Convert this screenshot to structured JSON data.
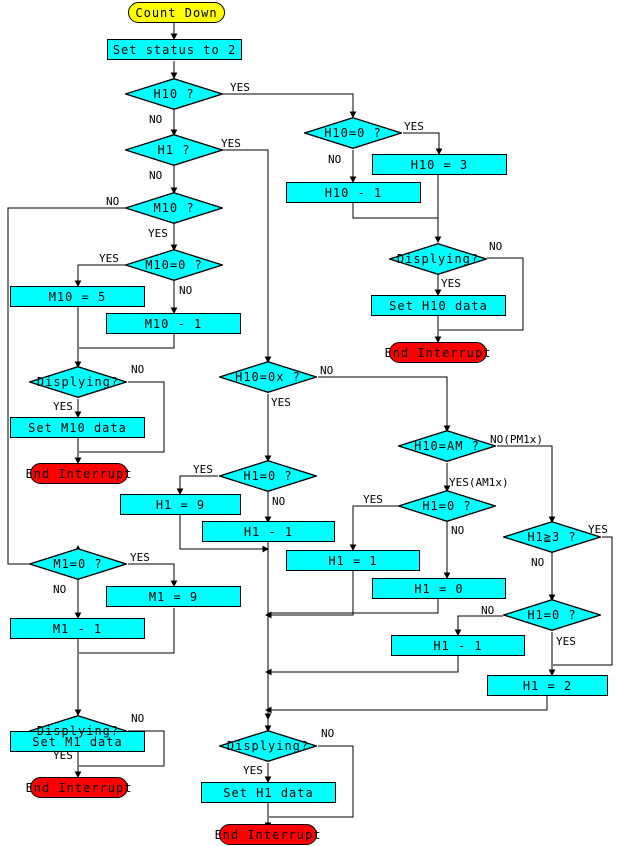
{
  "diagram": {
    "title": "Count Down",
    "colors": {
      "process_fill": "#00ffff",
      "start_fill": "#ffff00",
      "end_fill": "#ff0000",
      "line": "#000000",
      "background": "#ffffff"
    }
  },
  "nodes": {
    "start": "Count Down",
    "set_status": "Set status to 2",
    "d_h10": "H10 ?",
    "d_h1": "H1 ?",
    "d_m10": "M10 ?",
    "d_m10_eq0": "M10=0 ?",
    "m10_set5": "M10 = 5",
    "m10_dec": "M10 - 1",
    "d_disp_m10": "Displying?",
    "set_m10_data": "Set M10 data",
    "end_m10": "End Interrupt",
    "d_h10_eq0": "H10=0 ?",
    "h10_set3": "H10 = 3",
    "h10_dec": "H10 - 1",
    "d_disp_h10": "Displying?",
    "set_h10_data": "Set H10 data",
    "end_h10": "End Interrupt",
    "d_h10_0x": "H10=0x ?",
    "d_h1_eq0_left": "H1=0 ?",
    "h1_set9": "H1 = 9",
    "h1_dec_left": "H1 - 1",
    "d_h10_am": "H10=AM ?",
    "d_h1_eq0_am": "H1=0 ?",
    "h1_set1": "H1 = 1",
    "h1_set0": "H1 = 0",
    "h1_dec_right": "H1 - 1",
    "d_h1_ge3": "H1≧3 ?",
    "d_h1_eq0_pm": "H1=0 ?",
    "h1_set2": "H1 = 2",
    "d_m1_eq0": "M1=0 ?",
    "m1_set9": "M1 = 9",
    "m1_dec": "M1 - 1",
    "d_disp_m1": "Displying?",
    "set_m1_data": "Set M1 data",
    "end_m1": "End Interrupt",
    "d_disp_h1": "Displying?",
    "set_h1_data": "Set H1 data",
    "end_h1": "End Interrupt"
  },
  "edge_labels": {
    "h10_yes": "YES",
    "h10_no": "NO",
    "h1_yes": "YES",
    "h1_no": "NO",
    "m10_no": "NO",
    "m10_yes": "YES",
    "m10_eq0_yes": "YES",
    "m10_eq0_no": "NO",
    "disp_m10_no": "NO",
    "disp_m10_yes": "YES",
    "h10_eq0_yes": "YES",
    "h10_eq0_no": "NO",
    "disp_h10_no": "NO",
    "disp_h10_yes": "YES",
    "h10_0x_no": "NO",
    "h10_0x_yes": "YES",
    "h1_eq0_left_yes": "YES",
    "h1_eq0_left_no": "NO",
    "h10_am_no": "NO(PM1x)",
    "h10_am_yes": "YES(AM1x)",
    "h1_eq0_am_yes": "YES",
    "h1_eq0_am_no": "NO",
    "h1_set0_no": "NO",
    "h1_ge3_yes": "YES",
    "h1_ge3_no": "NO",
    "h1_eq0_pm_yes": "YES",
    "m1_eq0_yes": "YES",
    "m1_eq0_no": "NO",
    "disp_m1_no": "NO",
    "disp_m1_yes": "YES",
    "disp_h1_no": "NO",
    "disp_h1_yes": "YES"
  }
}
